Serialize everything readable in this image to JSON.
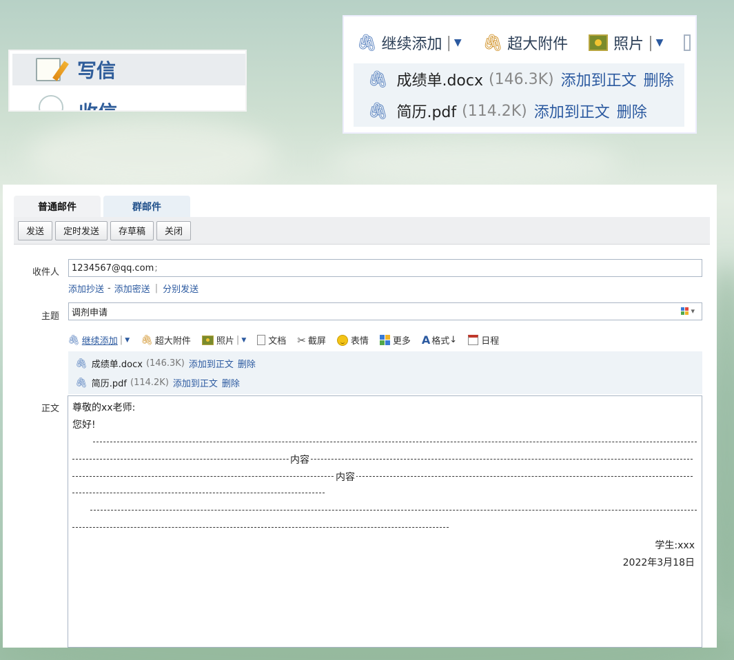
{
  "sidebar_zoom": {
    "write_label": "写信",
    "receive_label": "收信"
  },
  "attach_zoom": {
    "toolbar": {
      "continue_add": "继续添加",
      "large_attach": "超大附件",
      "photo": "照片"
    },
    "attachments": [
      {
        "name": "成绩单.docx",
        "size": "(146.3K)",
        "add_to_body": "添加到正文",
        "delete": "删除"
      },
      {
        "name": "简历.pdf",
        "size": "(114.2K)",
        "add_to_body": "添加到正文",
        "delete": "删除"
      }
    ]
  },
  "compose": {
    "tabs": [
      {
        "label": "普通邮件",
        "active": true
      },
      {
        "label": "群邮件",
        "active": false
      }
    ],
    "toolbar": {
      "send": "发送",
      "scheduled_send": "定时发送",
      "save_draft": "存草稿",
      "close": "关闭"
    },
    "recipient": {
      "label": "收件人",
      "value": "1234567@qq.com",
      "separator": ";"
    },
    "recipient_links": {
      "add_cc": "添加抄送",
      "dash": "-",
      "add_bcc": "添加密送",
      "bar": "|",
      "separate_send": "分别发送"
    },
    "subject": {
      "label": "主题",
      "value": "调剂申请"
    },
    "attach_toolbar": {
      "continue_add": "继续添加",
      "large_attach": "超大附件",
      "photo": "照片",
      "document": "文档",
      "screenshot": "截屏",
      "emoji": "表情",
      "more": "更多",
      "format": "格式",
      "schedule": "日程"
    },
    "attachments": [
      {
        "name": "成绩单.docx",
        "size": "(146.3K)",
        "add_to_body": "添加到正文",
        "delete": "删除"
      },
      {
        "name": "简历.pdf",
        "size": "(114.2K)",
        "add_to_body": "添加到正文",
        "delete": "删除"
      }
    ],
    "body": {
      "label": "正文",
      "greeting": "尊敬的xx老师:",
      "hello": "您好!",
      "content_word_1": "内容",
      "content_word_2": "内容",
      "signature_student": "学生:xxx",
      "signature_date": "2022年3月18日"
    }
  },
  "colors": {
    "link": "#2c5aa0",
    "tab_inactive_text": "#1f4f8a",
    "attach_bg": "#eef3f7"
  }
}
